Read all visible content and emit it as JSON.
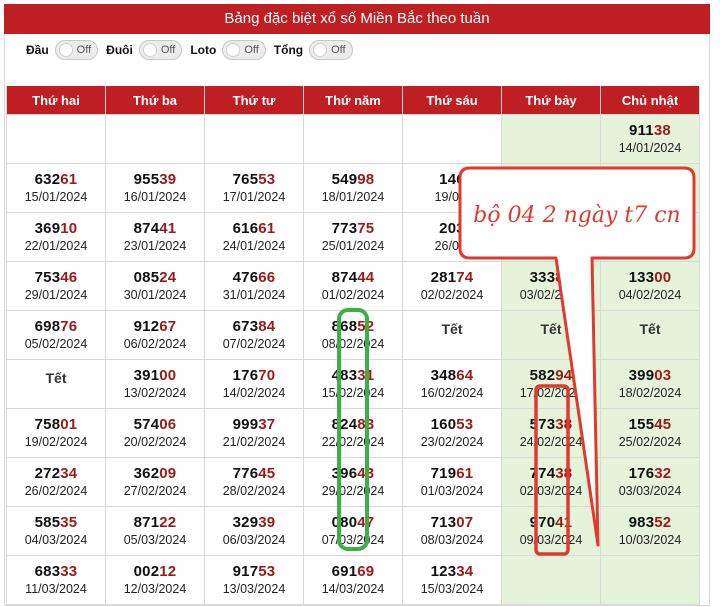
{
  "header": {
    "title": "Bảng đặc biệt xổ số Miền Bắc theo tuần"
  },
  "toggles": [
    {
      "label": "Đầu",
      "state": "Off"
    },
    {
      "label": "Đuôi",
      "state": "Off"
    },
    {
      "label": "Loto",
      "state": "Off"
    },
    {
      "label": "Tổng",
      "state": "Off"
    }
  ],
  "table": {
    "columns": [
      "Thứ hai",
      "Thứ ba",
      "Thứ tư",
      "Thứ năm",
      "Thứ sáu",
      "Thứ bảy",
      "Chủ nhật"
    ],
    "rows": [
      [
        {},
        {},
        {},
        {},
        {},
        {},
        {
          "head": "911",
          "tail": "38",
          "date": "14/01/2024"
        }
      ],
      [
        {
          "head": "632",
          "tail": "61",
          "date": "15/01/2024"
        },
        {
          "head": "955",
          "tail": "39",
          "date": "16/01/2024"
        },
        {
          "head": "765",
          "tail": "53",
          "date": "17/01/2024"
        },
        {
          "head": "549",
          "tail": "98",
          "date": "18/01/2024"
        },
        {
          "head": "146",
          "tail": "",
          "date": "19/01/"
        },
        {},
        {}
      ],
      [
        {
          "head": "369",
          "tail": "10",
          "date": "22/01/2024"
        },
        {
          "head": "874",
          "tail": "41",
          "date": "23/01/2024"
        },
        {
          "head": "616",
          "tail": "61",
          "date": "24/01/2024"
        },
        {
          "head": "773",
          "tail": "75",
          "date": "25/01/2024"
        },
        {
          "head": "203",
          "tail": "",
          "date": "26/01/"
        },
        {},
        {}
      ],
      [
        {
          "head": "753",
          "tail": "46",
          "date": "29/01/2024"
        },
        {
          "head": "085",
          "tail": "24",
          "date": "30/01/2024"
        },
        {
          "head": "476",
          "tail": "66",
          "date": "31/01/2024"
        },
        {
          "head": "874",
          "tail": "44",
          "date": "01/02/2024"
        },
        {
          "head": "281",
          "tail": "74",
          "date": "02/02/2024"
        },
        {
          "head": "333",
          "tail": "89",
          "date": "03/02/2024"
        },
        {
          "head": "133",
          "tail": "00",
          "date": "04/02/2024"
        }
      ],
      [
        {
          "head": "698",
          "tail": "76",
          "date": "05/02/2024"
        },
        {
          "head": "912",
          "tail": "67",
          "date": "06/02/2024"
        },
        {
          "head": "673",
          "tail": "84",
          "date": "07/02/2024"
        },
        {
          "head": "868",
          "tail": "52",
          "date": "08/02/2024"
        },
        {
          "tet": "Tết"
        },
        {
          "tet": "Tết"
        },
        {
          "tet": "Tết"
        }
      ],
      [
        {
          "tet": "Tết"
        },
        {
          "head": "391",
          "tail": "00",
          "date": "13/02/2024"
        },
        {
          "head": "176",
          "tail": "70",
          "date": "14/02/2024"
        },
        {
          "head": "483",
          "tail": "31",
          "date": "15/02/2024"
        },
        {
          "head": "348",
          "tail": "64",
          "date": "16/02/2024"
        },
        {
          "head": "582",
          "tail": "94",
          "date": "17/02/2024"
        },
        {
          "head": "399",
          "tail": "03",
          "date": "18/02/2024"
        }
      ],
      [
        {
          "head": "758",
          "tail": "01",
          "date": "19/02/2024"
        },
        {
          "head": "574",
          "tail": "06",
          "date": "20/02/2024"
        },
        {
          "head": "999",
          "tail": "37",
          "date": "21/02/2024"
        },
        {
          "head": "824",
          "tail": "83",
          "date": "22/02/2024"
        },
        {
          "head": "160",
          "tail": "53",
          "date": "23/02/2024"
        },
        {
          "head": "573",
          "tail": "38",
          "date": "24/02/2024"
        },
        {
          "head": "155",
          "tail": "45",
          "date": "25/02/2024"
        }
      ],
      [
        {
          "head": "272",
          "tail": "34",
          "date": "26/02/2024"
        },
        {
          "head": "362",
          "tail": "09",
          "date": "27/02/2024"
        },
        {
          "head": "776",
          "tail": "45",
          "date": "28/02/2024"
        },
        {
          "head": "396",
          "tail": "43",
          "date": "29/02/2024"
        },
        {
          "head": "719",
          "tail": "61",
          "date": "01/03/2024"
        },
        {
          "head": "774",
          "tail": "38",
          "date": "02/03/2024"
        },
        {
          "head": "176",
          "tail": "32",
          "date": "03/03/2024"
        }
      ],
      [
        {
          "head": "585",
          "tail": "35",
          "date": "04/03/2024"
        },
        {
          "head": "871",
          "tail": "22",
          "date": "05/03/2024"
        },
        {
          "head": "329",
          "tail": "39",
          "date": "06/03/2024"
        },
        {
          "head": "080",
          "tail": "47",
          "date": "07/03/2024"
        },
        {
          "head": "713",
          "tail": "07",
          "date": "08/03/2024"
        },
        {
          "head": "970",
          "tail": "41",
          "date": "09/03/2024"
        },
        {
          "head": "983",
          "tail": "52",
          "date": "10/03/2024"
        }
      ],
      [
        {
          "head": "683",
          "tail": "33",
          "date": "11/03/2024"
        },
        {
          "head": "002",
          "tail": "12",
          "date": "12/03/2024"
        },
        {
          "head": "917",
          "tail": "53",
          "date": "13/03/2024"
        },
        {
          "head": "691",
          "tail": "69",
          "date": "14/03/2024"
        },
        {
          "head": "123",
          "tail": "34",
          "date": "15/03/2024"
        },
        {},
        {}
      ]
    ]
  },
  "annotation": {
    "callout_text": "bộ 04 2 ngày t7 cn",
    "colors": {
      "red": "#e03a2e",
      "green": "#3fae49"
    }
  }
}
